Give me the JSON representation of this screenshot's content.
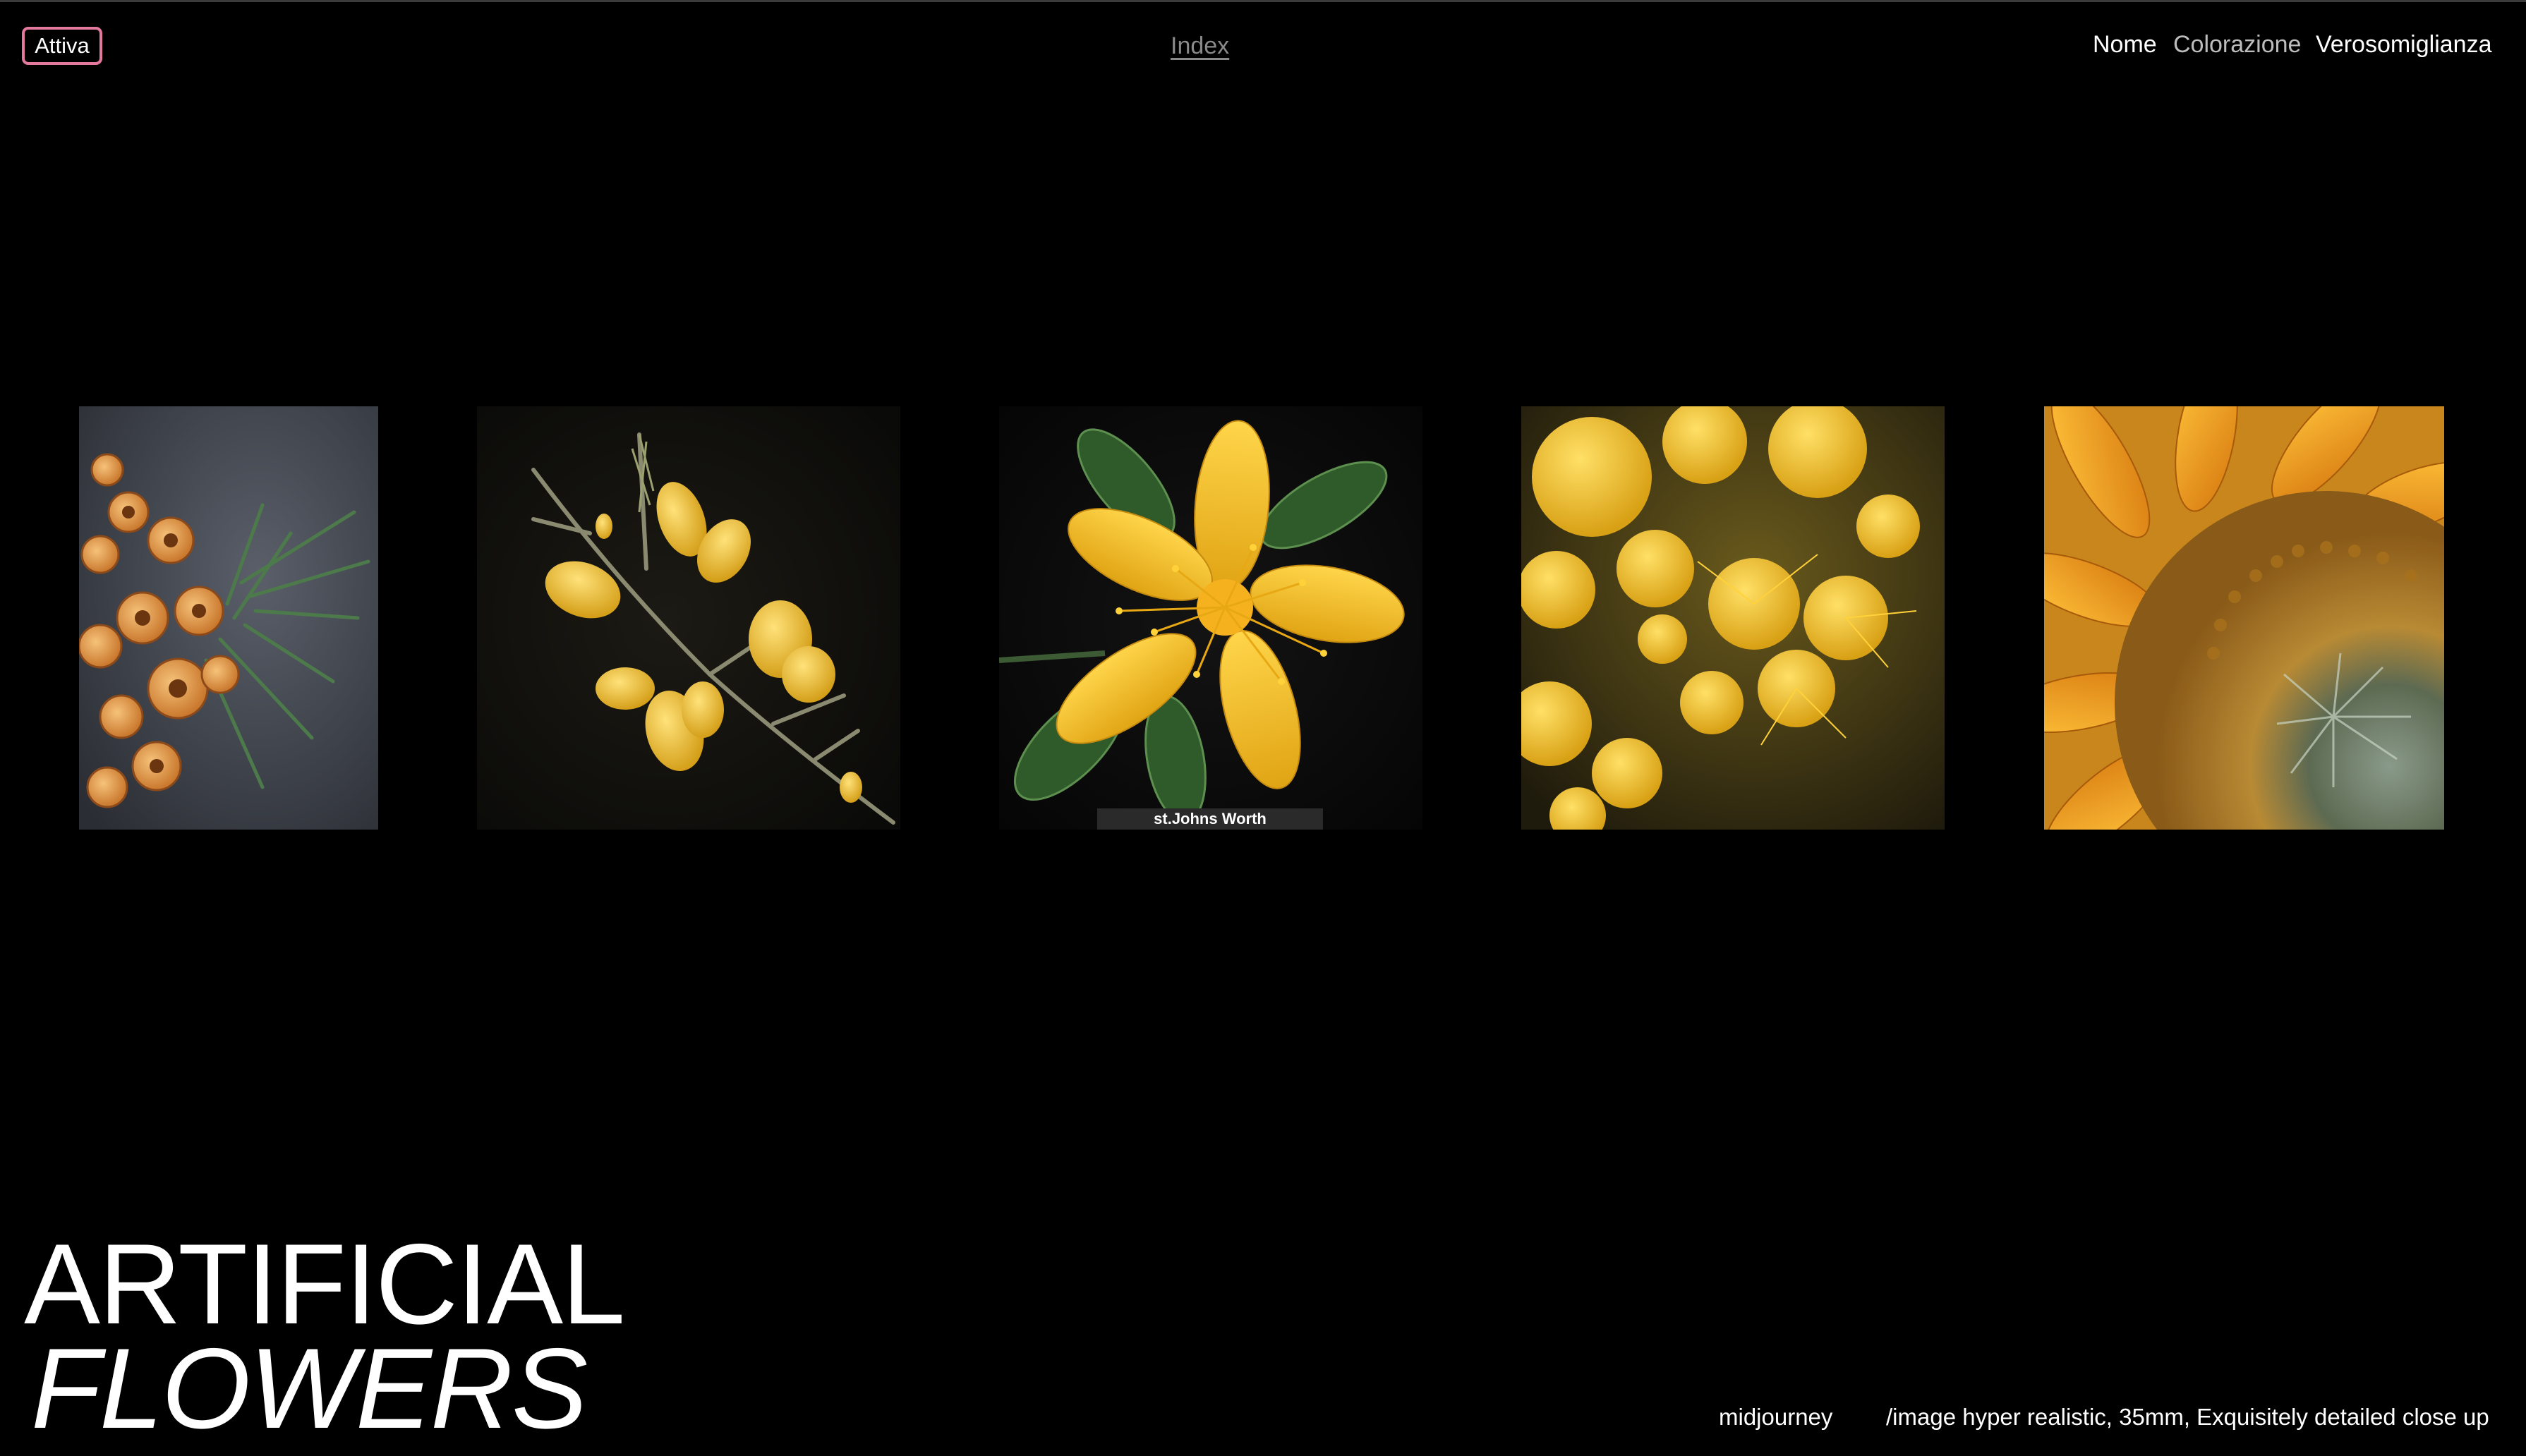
{
  "header": {
    "toggle_label": "Attiva",
    "index_link": "Index",
    "sort_options": [
      {
        "label": "Nome",
        "active": true
      },
      {
        "label": "Colorazione",
        "active": false
      },
      {
        "label": "Verosomiglianza",
        "active": true
      }
    ]
  },
  "gallery": {
    "items": [
      {
        "name": "card-1",
        "caption": ""
      },
      {
        "name": "card-2",
        "caption": ""
      },
      {
        "name": "card-3",
        "caption": "st.Johns Worth"
      },
      {
        "name": "card-4",
        "caption": ""
      },
      {
        "name": "card-5",
        "caption": ""
      }
    ]
  },
  "title": {
    "line1": "ARTIFICIAL",
    "line2": "FLOWERS"
  },
  "footer": {
    "model": "midjourney",
    "prompt": "/image hyper realistic, 35mm, Exquisitely detailed close up"
  },
  "colors": {
    "background": "#000000",
    "toggle_border": "#e3799c",
    "muted_text": "#8a8a8a",
    "flower_yellow": "#f2c12e"
  }
}
